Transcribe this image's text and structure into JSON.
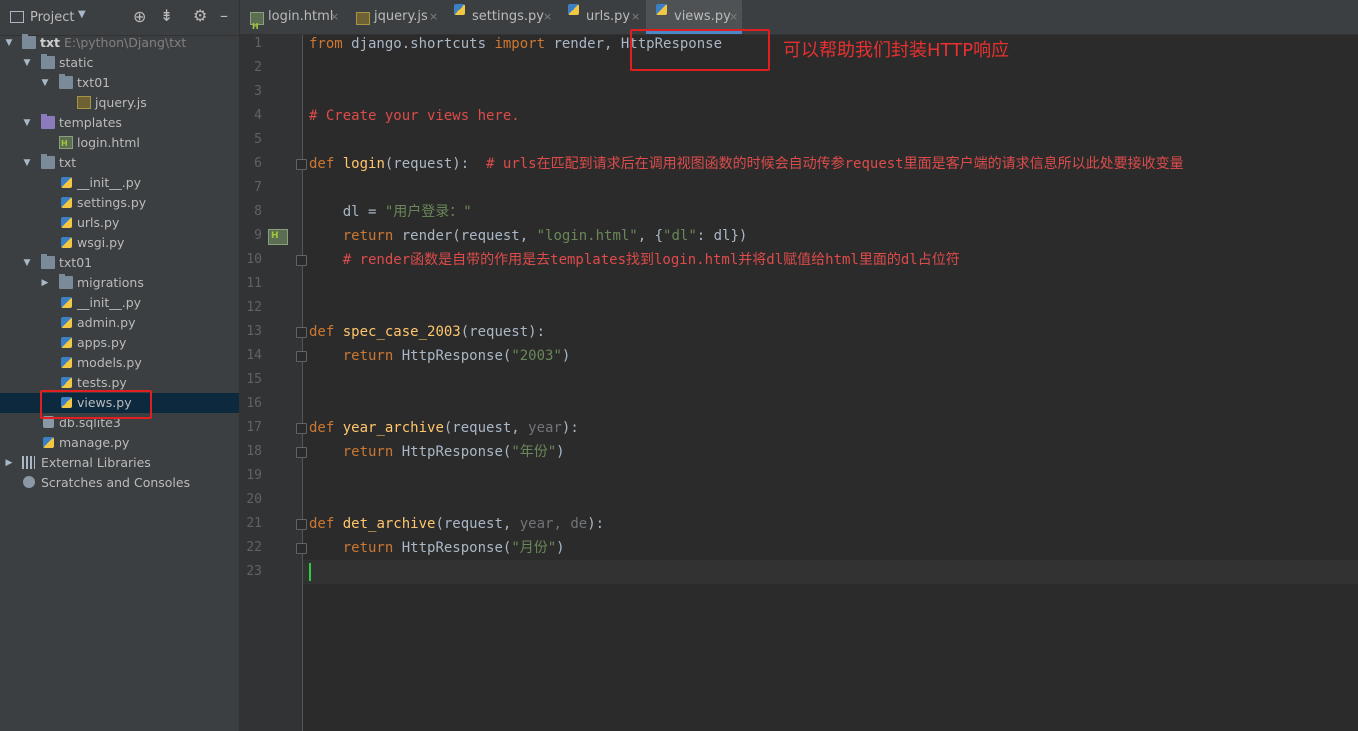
{
  "panel": {
    "title": "Project",
    "tree": [
      {
        "label": "txt",
        "path": "E:\\python\\Djang\\txt",
        "icon": "folder-icon"
      },
      {
        "label": "static",
        "icon": "folder-icon"
      },
      {
        "label": "txt01",
        "icon": "folder-icon"
      },
      {
        "label": "jquery.js",
        "icon": "js-file-icon"
      },
      {
        "label": "templates",
        "icon": "templates-folder-icon"
      },
      {
        "label": "login.html",
        "icon": "html-file-icon"
      },
      {
        "label": "txt",
        "icon": "folder-icon"
      },
      {
        "label": "__init__.py",
        "icon": "python-file-icon"
      },
      {
        "label": "settings.py",
        "icon": "python-file-icon"
      },
      {
        "label": "urls.py",
        "icon": "python-file-icon"
      },
      {
        "label": "wsgi.py",
        "icon": "python-file-icon"
      },
      {
        "label": "txt01",
        "icon": "folder-icon"
      },
      {
        "label": "migrations",
        "icon": "folder-icon"
      },
      {
        "label": "__init__.py",
        "icon": "python-file-icon"
      },
      {
        "label": "admin.py",
        "icon": "python-file-icon"
      },
      {
        "label": "apps.py",
        "icon": "python-file-icon"
      },
      {
        "label": "models.py",
        "icon": "python-file-icon"
      },
      {
        "label": "tests.py",
        "icon": "python-file-icon"
      },
      {
        "label": "views.py",
        "icon": "python-file-icon"
      },
      {
        "label": "db.sqlite3",
        "icon": "database-icon"
      },
      {
        "label": "manage.py",
        "icon": "python-file-icon"
      },
      {
        "label": "External Libraries",
        "icon": "library-icon"
      },
      {
        "label": "Scratches and Consoles",
        "icon": "scratches-icon"
      }
    ]
  },
  "tabs": [
    {
      "label": "login.html",
      "icon": "html-file-icon"
    },
    {
      "label": "jquery.js",
      "icon": "js-file-icon"
    },
    {
      "label": "settings.py",
      "icon": "python-file-icon"
    },
    {
      "label": "urls.py",
      "icon": "python-file-icon"
    },
    {
      "label": "views.py",
      "icon": "python-file-icon",
      "active": true
    }
  ],
  "close_glyph": "×",
  "editor": {
    "line_numbers": [
      "1",
      "2",
      "3",
      "4",
      "5",
      "6",
      "7",
      "8",
      "9",
      "10",
      "11",
      "12",
      "13",
      "14",
      "15",
      "16",
      "17",
      "18",
      "19",
      "20",
      "21",
      "22",
      "23"
    ],
    "code": {
      "l1": {
        "k1": "from",
        "a": " django.shortcuts ",
        "k2": "import",
        "b": " render, HttpResponse"
      },
      "l4": {
        "c": "# Create your views here."
      },
      "l6": {
        "k": "def",
        "f": " login",
        "p1": "(request):",
        "c": "  # urls在匹配到请求后在调用视图函数的时候会自动传参request里面是客户端的请求信息所以此处要接收变量"
      },
      "l8": {
        "a": "    dl = ",
        "s": "\"用户登录：\""
      },
      "l9": {
        "k": "    return",
        "a": " render(request, ",
        "s1": "\"login.html\"",
        "b": ", {",
        "s2": "\"dl\"",
        "c": ": dl})"
      },
      "l10": {
        "c": "    # render函数是自带的作用是去templates找到login.html并将dl赋值给html里面的dl占位符"
      },
      "l13": {
        "k": "def",
        "f": " spec_case_2003",
        "p": "(request):"
      },
      "l14": {
        "k": "    return",
        "a": " HttpResponse(",
        "s": "\"2003\"",
        "b": ")"
      },
      "l17": {
        "k": "def",
        "f": " year_archive",
        "a": "(request, ",
        "d": "year",
        "b": "):"
      },
      "l18": {
        "k": "    return",
        "a": " HttpResponse(",
        "s": "\"年份\"",
        "b": ")"
      },
      "l21": {
        "k": "def",
        "f": " det_archive",
        "a": "(request, ",
        "d1": "year",
        "m": ", ",
        "d2": "de",
        "b": "):"
      },
      "l22": {
        "k": "    return",
        "a": " HttpResponse(",
        "s": "\"月份\"",
        "b": ")"
      }
    }
  },
  "annotation": {
    "text": "可以帮助我们封装HTTP响应"
  },
  "colors": {
    "accent": "#4a88c7",
    "annotation": "#e02020"
  }
}
